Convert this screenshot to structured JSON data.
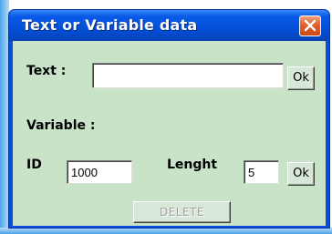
{
  "window": {
    "title": "Text or Variable data",
    "close_icon": "close-x-icon"
  },
  "text_section": {
    "label": "Text :",
    "value": "",
    "ok_label": "Ok"
  },
  "variable_section": {
    "label": "Variable :",
    "id_label": "ID",
    "id_value": "1000",
    "length_label": "Lenght",
    "length_value": "5",
    "ok_label": "Ok"
  },
  "delete_label": "DELETE",
  "colors": {
    "titlebar": "#0450d8",
    "client_bg": "#c9e3c9",
    "close_button": "#e1602e"
  }
}
